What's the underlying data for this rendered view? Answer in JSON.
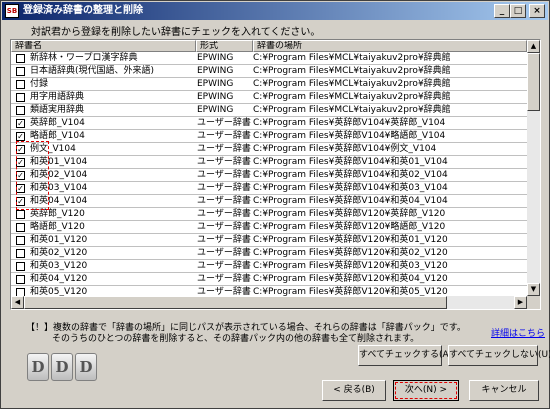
{
  "window": {
    "title": "登録済み辞書の整理と削除",
    "app_badge": "SB"
  },
  "instruction": "対訳君から登録を削除したい辞書にチェックを入れてください。",
  "columns": {
    "name": "辞書名",
    "format": "形式",
    "path": "辞書の場所"
  },
  "rows": [
    {
      "checked": false,
      "name": "新辞林・ワープロ漢字辞典",
      "format": "EPWING",
      "path": "C:¥Program Files¥MCL¥taiyakuv2pro¥辞典館"
    },
    {
      "checked": false,
      "name": "日本語辞典(現代国語、外来語)",
      "format": "EPWING",
      "path": "C:¥Program Files¥MCL¥taiyakuv2pro¥辞典館"
    },
    {
      "checked": false,
      "name": "付録",
      "format": "EPWING",
      "path": "C:¥Program Files¥MCL¥taiyakuv2pro¥辞典館"
    },
    {
      "checked": false,
      "name": "用字用語辞典",
      "format": "EPWING",
      "path": "C:¥Program Files¥MCL¥taiyakuv2pro¥辞典館"
    },
    {
      "checked": false,
      "name": "類語実用辞典",
      "format": "EPWING",
      "path": "C:¥Program Files¥MCL¥taiyakuv2pro¥辞典館"
    },
    {
      "checked": true,
      "name": "英辞郎_V104",
      "format": "ユーザー辞書",
      "path": "C:¥Program Files¥英辞郎V104¥英辞郎_V104"
    },
    {
      "checked": true,
      "name": "略語郎_V104",
      "format": "ユーザー辞書",
      "path": "C:¥Program Files¥英辞郎V104¥略語郎_V104"
    },
    {
      "checked": true,
      "name": "例文_V104",
      "format": "ユーザー辞書",
      "path": "C:¥Program Files¥英辞郎V104¥例文_V104"
    },
    {
      "checked": true,
      "name": "和英01_V104",
      "format": "ユーザー辞書",
      "path": "C:¥Program Files¥英辞郎V104¥和英01_V104"
    },
    {
      "checked": true,
      "name": "和英02_V104",
      "format": "ユーザー辞書",
      "path": "C:¥Program Files¥英辞郎V104¥和英02_V104"
    },
    {
      "checked": true,
      "name": "和英03_V104",
      "format": "ユーザー辞書",
      "path": "C:¥Program Files¥英辞郎V104¥和英03_V104"
    },
    {
      "checked": true,
      "name": "和英04_V104",
      "format": "ユーザー辞書",
      "path": "C:¥Program Files¥英辞郎V104¥和英04_V104"
    },
    {
      "checked": false,
      "name": "英辞郎_V120",
      "format": "ユーザー辞書",
      "path": "C:¥Program Files¥英辞郎V120¥英辞郎_V120"
    },
    {
      "checked": false,
      "name": "略語郎_V120",
      "format": "ユーザー辞書",
      "path": "C:¥Program Files¥英辞郎V120¥略語郎_V120"
    },
    {
      "checked": false,
      "name": "和英01_V120",
      "format": "ユーザー辞書",
      "path": "C:¥Program Files¥英辞郎V120¥和英01_V120"
    },
    {
      "checked": false,
      "name": "和英02_V120",
      "format": "ユーザー辞書",
      "path": "C:¥Program Files¥英辞郎V120¥和英02_V120"
    },
    {
      "checked": false,
      "name": "和英03_V120",
      "format": "ユーザー辞書",
      "path": "C:¥Program Files¥英辞郎V120¥和英03_V120"
    },
    {
      "checked": false,
      "name": "和英04_V120",
      "format": "ユーザー辞書",
      "path": "C:¥Program Files¥英辞郎V120¥和英04_V120"
    },
    {
      "checked": false,
      "name": "和英05_V120",
      "format": "ユーザー辞書",
      "path": "C:¥Program Files¥英辞郎V120¥和英05_V120"
    }
  ],
  "note": {
    "line1": "【！】複数の辞書で「辞書の場所」に同じパスが表示されている場合、それらの辞書は「辞書パック」です。",
    "line2": "そのうちのひとつの辞書を削除すると、その辞書パック内の他の辞書も全て削除されます。"
  },
  "detail_link": "詳細はこちら",
  "icons": {
    "dict_letter": "D"
  },
  "buttons": {
    "check_all": "すべてチェックする(A)",
    "uncheck_all": "すべてチェックしない(U)",
    "back": "< 戻る(B)",
    "next": "次へ(N) >",
    "cancel": "キャンセル"
  },
  "colors": {
    "title_bar": "#0a246a",
    "highlight": "#e00000",
    "link": "#0000ee"
  }
}
